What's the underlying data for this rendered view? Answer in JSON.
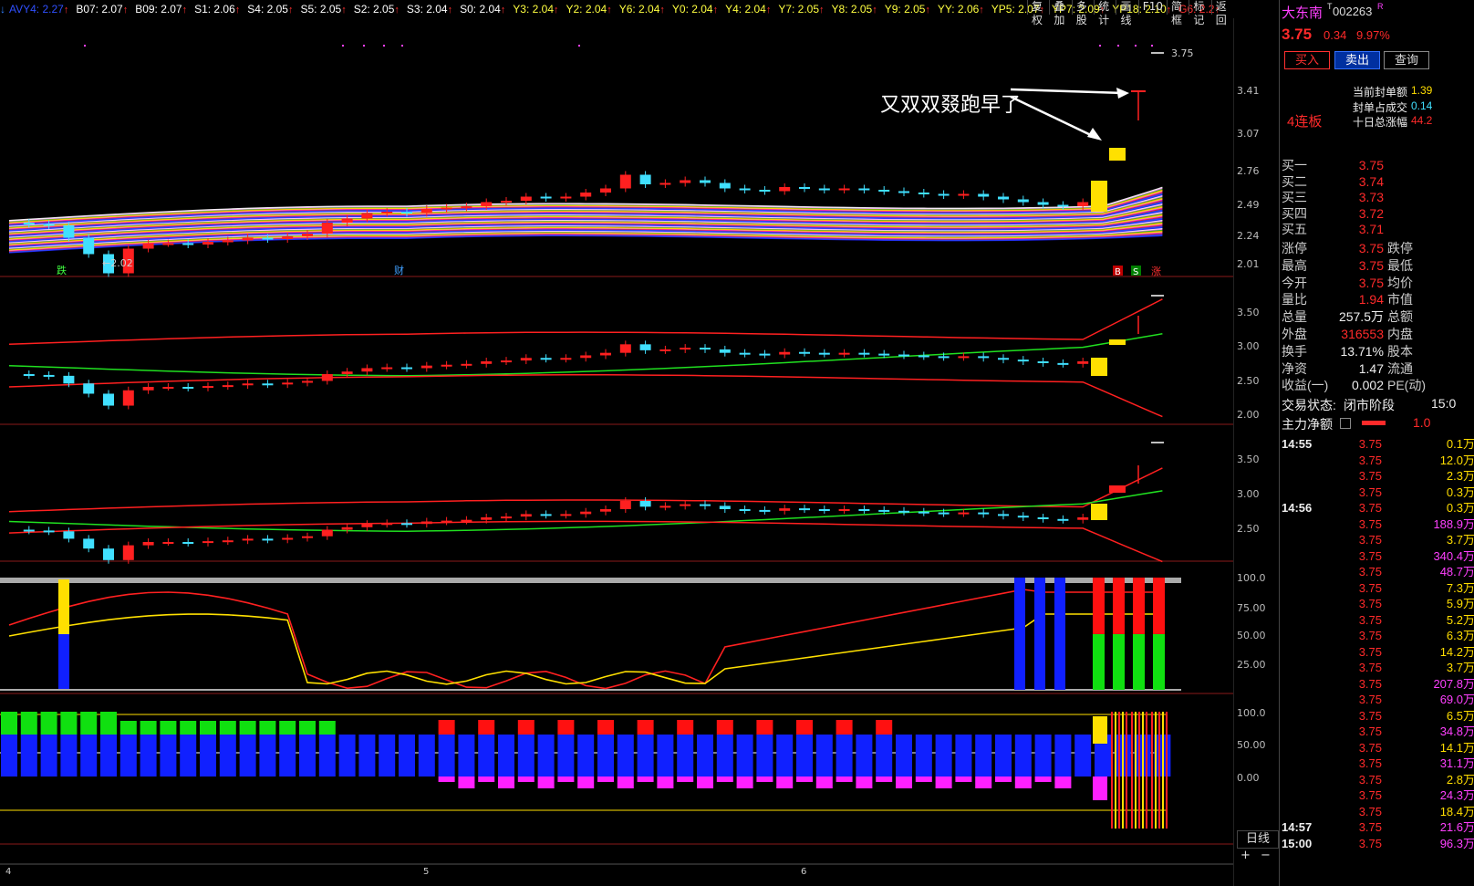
{
  "top_indicators": [
    {
      "label": "AVY4: 2.27",
      "color": "#3050ff"
    },
    {
      "label": "B07: 2.07",
      "color": "#ffffff"
    },
    {
      "label": "B09: 2.07",
      "color": "#ffffff"
    },
    {
      "label": "S1: 2.06",
      "color": "#ffffff"
    },
    {
      "label": "S4: 2.05",
      "color": "#ffffff"
    },
    {
      "label": "S5: 2.05",
      "color": "#ffffff"
    },
    {
      "label": "S2: 2.05",
      "color": "#ffffff"
    },
    {
      "label": "S3: 2.04",
      "color": "#ffffff"
    },
    {
      "label": "S0: 2.04",
      "color": "#ffffff"
    },
    {
      "label": "Y3: 2.04",
      "color": "#ffff40"
    },
    {
      "label": "Y2: 2.04",
      "color": "#ffff40"
    },
    {
      "label": "Y6: 2.04",
      "color": "#ffff40"
    },
    {
      "label": "Y0: 2.04",
      "color": "#ffff40"
    },
    {
      "label": "Y4: 2.04",
      "color": "#ffff40"
    },
    {
      "label": "Y7: 2.05",
      "color": "#ffff40"
    },
    {
      "label": "Y8: 2.05",
      "color": "#ffff40"
    },
    {
      "label": "Y9: 2.05",
      "color": "#ffff40"
    },
    {
      "label": "YY: 2.06",
      "color": "#ffff40"
    },
    {
      "label": "YP5: 2.07",
      "color": "#ffff40"
    },
    {
      "label": "YP7: 2.09",
      "color": "#ffff40"
    },
    {
      "label": "YP18: 2.10",
      "color": "#ffff40"
    },
    {
      "label": "G6: 2.2",
      "color": "#ff3030"
    }
  ],
  "toolbar": [
    "复权",
    "叠加",
    "多股",
    "统计",
    "画线",
    "F10",
    "简框",
    "标记",
    "返回"
  ],
  "chart": {
    "annotation": "又双双叕跑早了",
    "price_mark_top": "3.75",
    "low_mark": "←2.02",
    "markers": {
      "die": "跌",
      "cai": "财",
      "b": "B",
      "s": "S",
      "zhang": "涨"
    },
    "axis1": [
      "3.41",
      "3.07",
      "2.76",
      "2.49",
      "2.24",
      "2.01"
    ],
    "axis2": [
      "3.50",
      "3.00",
      "2.50",
      "2.00"
    ],
    "axis3": [
      "3.50",
      "3.00",
      "2.50"
    ],
    "axis4": [
      "100.0",
      "75.00",
      "50.00",
      "25.00"
    ],
    "axis5": [
      "100.0",
      "50.00",
      "0.00"
    ],
    "x_labels": [
      "4",
      "5",
      "6"
    ],
    "period_label": "日线",
    "zoom_plus": "+",
    "zoom_minus": "−"
  },
  "chart_data": {
    "type": "candlestick",
    "closes": [
      2.45,
      2.44,
      2.43,
      2.34,
      2.22,
      2.08,
      2.26,
      2.3,
      2.3,
      2.29,
      2.31,
      2.32,
      2.34,
      2.33,
      2.35,
      2.37,
      2.45,
      2.48,
      2.52,
      2.53,
      2.52,
      2.55,
      2.56,
      2.57,
      2.6,
      2.61,
      2.64,
      2.63,
      2.64,
      2.67,
      2.7,
      2.8,
      2.73,
      2.74,
      2.76,
      2.74,
      2.7,
      2.69,
      2.68,
      2.71,
      2.7,
      2.69,
      2.7,
      2.69,
      2.68,
      2.67,
      2.66,
      2.65,
      2.66,
      2.64,
      2.62,
      2.6,
      2.58,
      2.57,
      2.6,
      2.86,
      3.15,
      3.41,
      3.75
    ],
    "last_price": "3.75"
  },
  "panel": {
    "name": "大东南",
    "code": "002263",
    "code_sup_t": "T",
    "code_sup_r": "R",
    "price": "3.75",
    "change": "0.34",
    "pct": "9.97%",
    "buy_btn": "买入",
    "sell_btn": "卖出",
    "query_btn": "查询",
    "streak": "4连板",
    "seal_amt_label": "当前封单额",
    "seal_amt": "1.39",
    "seal_ratio_label": "封单占成交",
    "seal_ratio": "0.14",
    "ten_day_label": "十日总涨幅",
    "ten_day": "44.2",
    "bids": [
      {
        "label": "买一",
        "price": "3.75"
      },
      {
        "label": "买二",
        "price": "3.74"
      },
      {
        "label": "买三",
        "price": "3.73"
      },
      {
        "label": "买四",
        "price": "3.72"
      },
      {
        "label": "买五",
        "price": "3.71"
      }
    ],
    "stats": [
      {
        "l1": "涨停",
        "v1": "3.75",
        "c1": "red",
        "l2": "跌停"
      },
      {
        "l1": "最高",
        "v1": "3.75",
        "c1": "red",
        "l2": "最低"
      },
      {
        "l1": "今开",
        "v1": "3.75",
        "c1": "red",
        "l2": "均价"
      },
      {
        "l1": "量比",
        "v1": "1.94",
        "c1": "red",
        "l2": "市值"
      },
      {
        "l1": "总量",
        "v1": "257.5万",
        "c1": "wht",
        "l2": "总额"
      },
      {
        "l1": "外盘",
        "v1": "316553",
        "c1": "red",
        "l2": "内盘"
      },
      {
        "l1": "换手",
        "v1": "13.71%",
        "c1": "wht",
        "l2": "股本"
      },
      {
        "l1": "净资",
        "v1": "1.47",
        "c1": "wht",
        "l2": "流通"
      },
      {
        "l1": "收益(一)",
        "v1": "0.002",
        "c1": "wht",
        "l2": "PE(动)"
      }
    ],
    "trade_state_label": "交易状态:",
    "trade_state": "闭市阶段",
    "trade_time": "15:0",
    "main_flow_label": "主力净额",
    "main_flow": "1.0",
    "ticks": [
      {
        "t": "14:55",
        "p": "3.75",
        "v": "0.1万",
        "vc": "yel"
      },
      {
        "t": "",
        "p": "3.75",
        "v": "12.0万",
        "vc": "yel"
      },
      {
        "t": "",
        "p": "3.75",
        "v": "2.3万",
        "vc": "yel"
      },
      {
        "t": "",
        "p": "3.75",
        "v": "0.3万",
        "vc": "yel"
      },
      {
        "t": "14:56",
        "p": "3.75",
        "v": "0.3万",
        "vc": "yel"
      },
      {
        "t": "",
        "p": "3.75",
        "v": "188.9万",
        "vc": "mag"
      },
      {
        "t": "",
        "p": "3.75",
        "v": "3.7万",
        "vc": "yel"
      },
      {
        "t": "",
        "p": "3.75",
        "v": "340.4万",
        "vc": "mag"
      },
      {
        "t": "",
        "p": "3.75",
        "v": "48.7万",
        "vc": "mag"
      },
      {
        "t": "",
        "p": "3.75",
        "v": "7.3万",
        "vc": "yel"
      },
      {
        "t": "",
        "p": "3.75",
        "v": "5.9万",
        "vc": "yel"
      },
      {
        "t": "",
        "p": "3.75",
        "v": "5.2万",
        "vc": "yel"
      },
      {
        "t": "",
        "p": "3.75",
        "v": "6.3万",
        "vc": "yel"
      },
      {
        "t": "",
        "p": "3.75",
        "v": "14.2万",
        "vc": "yel"
      },
      {
        "t": "",
        "p": "3.75",
        "v": "3.7万",
        "vc": "yel"
      },
      {
        "t": "",
        "p": "3.75",
        "v": "207.8万",
        "vc": "mag"
      },
      {
        "t": "",
        "p": "3.75",
        "v": "69.0万",
        "vc": "mag"
      },
      {
        "t": "",
        "p": "3.75",
        "v": "6.5万",
        "vc": "yel"
      },
      {
        "t": "",
        "p": "3.75",
        "v": "34.8万",
        "vc": "mag"
      },
      {
        "t": "",
        "p": "3.75",
        "v": "14.1万",
        "vc": "yel"
      },
      {
        "t": "",
        "p": "3.75",
        "v": "31.1万",
        "vc": "mag"
      },
      {
        "t": "",
        "p": "3.75",
        "v": "2.8万",
        "vc": "yel"
      },
      {
        "t": "",
        "p": "3.75",
        "v": "24.3万",
        "vc": "mag"
      },
      {
        "t": "",
        "p": "3.75",
        "v": "18.4万",
        "vc": "yel"
      },
      {
        "t": "14:57",
        "p": "3.75",
        "v": "21.6万",
        "vc": "mag"
      },
      {
        "t": "15:00",
        "p": "3.75",
        "v": "96.3万",
        "vc": "mag"
      }
    ]
  }
}
